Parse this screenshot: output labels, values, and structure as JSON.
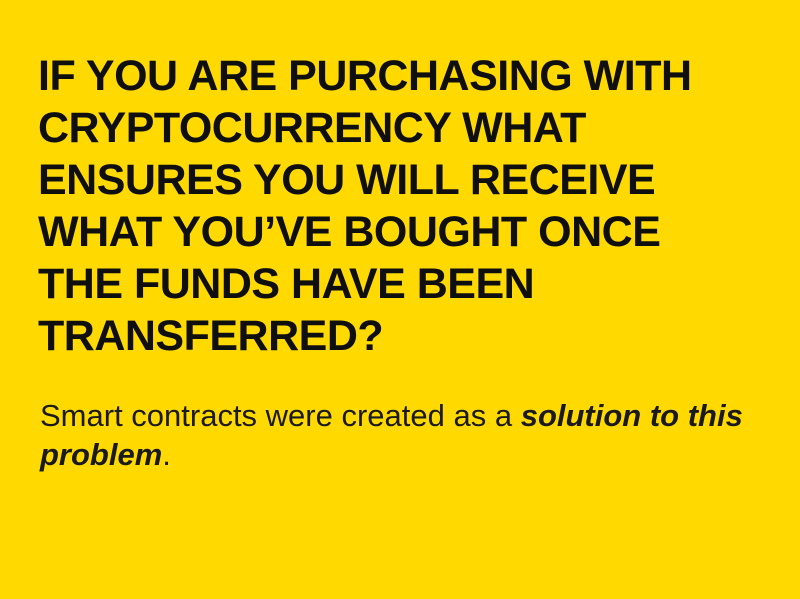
{
  "heading": {
    "lines": [
      "IF YOU ARE PURCHASING WITH",
      "CRYPTOCURRENCY WHAT",
      "ENSURES YOU WILL RECEIVE",
      "WHAT YOU’VE BOUGHT ONCE",
      "THE FUNDS HAVE BEEN",
      "TRANSFERRED?"
    ]
  },
  "body": {
    "lead": "Smart contracts were created as a ",
    "emphasis": "solution to this problem",
    "trail": "."
  },
  "colors": {
    "background": "#FFD900",
    "text": "#111111"
  }
}
